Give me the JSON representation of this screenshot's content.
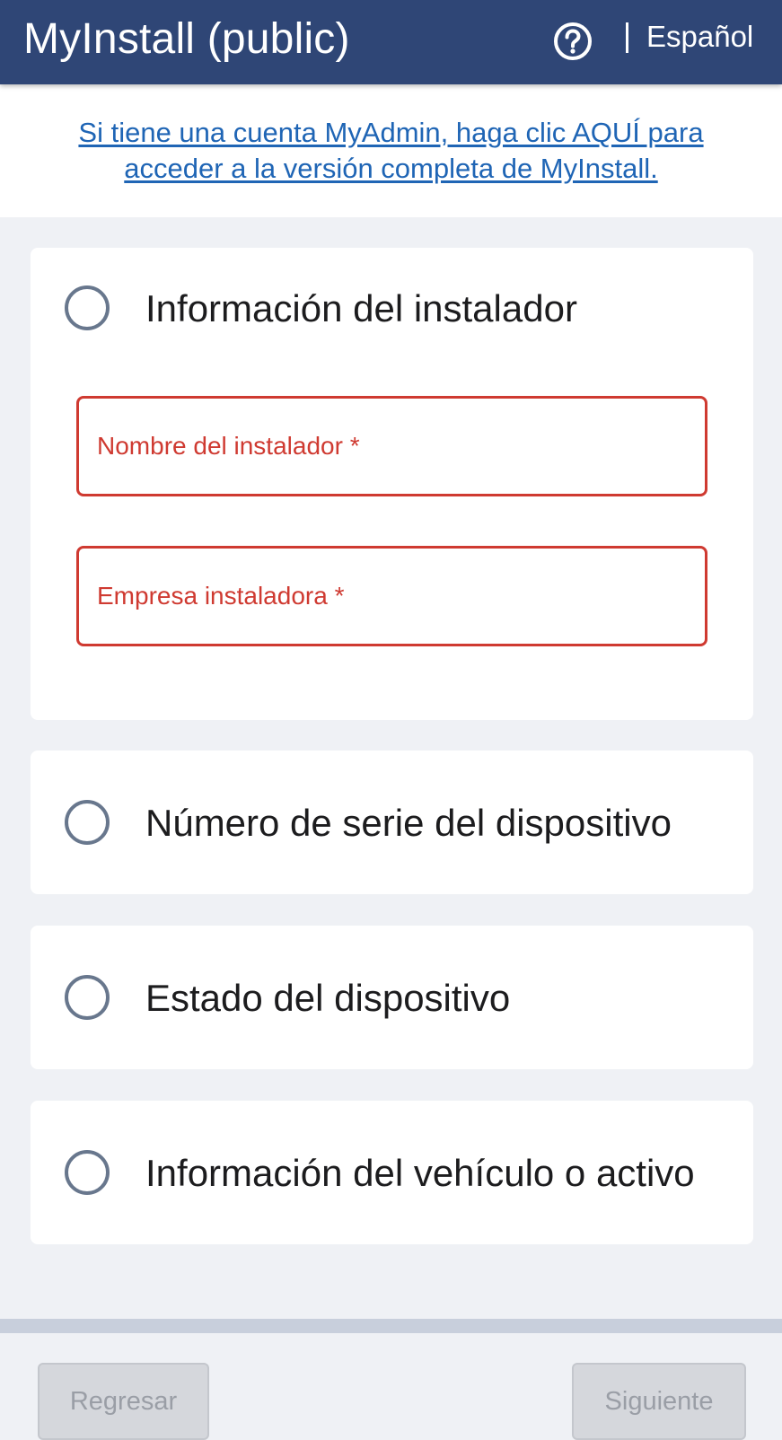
{
  "header": {
    "title": "MyInstall (public)",
    "help_icon": "help-circle-icon",
    "language": "Español"
  },
  "banner": {
    "link_text": "Si tiene una cuenta MyAdmin, haga clic AQUÍ para acceder a la versión completa de MyInstall."
  },
  "steps": [
    {
      "title": "Información del instalador",
      "state": "expanded",
      "fields": [
        {
          "placeholder": "Nombre del instalador *",
          "value": "",
          "state": "error"
        },
        {
          "placeholder": "Empresa instaladora *",
          "value": "",
          "state": "error"
        }
      ]
    },
    {
      "title": "Número de serie del dispositivo",
      "state": "collapsed"
    },
    {
      "title": "Estado del dispositivo",
      "state": "collapsed"
    },
    {
      "title": "Información del vehículo o activo",
      "state": "collapsed"
    }
  ],
  "footer": {
    "back_label": "Regresar",
    "next_label": "Siguiente"
  },
  "colors": {
    "header_bg": "#2f4676",
    "link": "#1f65b5",
    "error": "#cf3a31",
    "step_circle": "#68778d",
    "page_bg": "#eff1f5",
    "button_disabled_bg": "#d5d7dc"
  }
}
